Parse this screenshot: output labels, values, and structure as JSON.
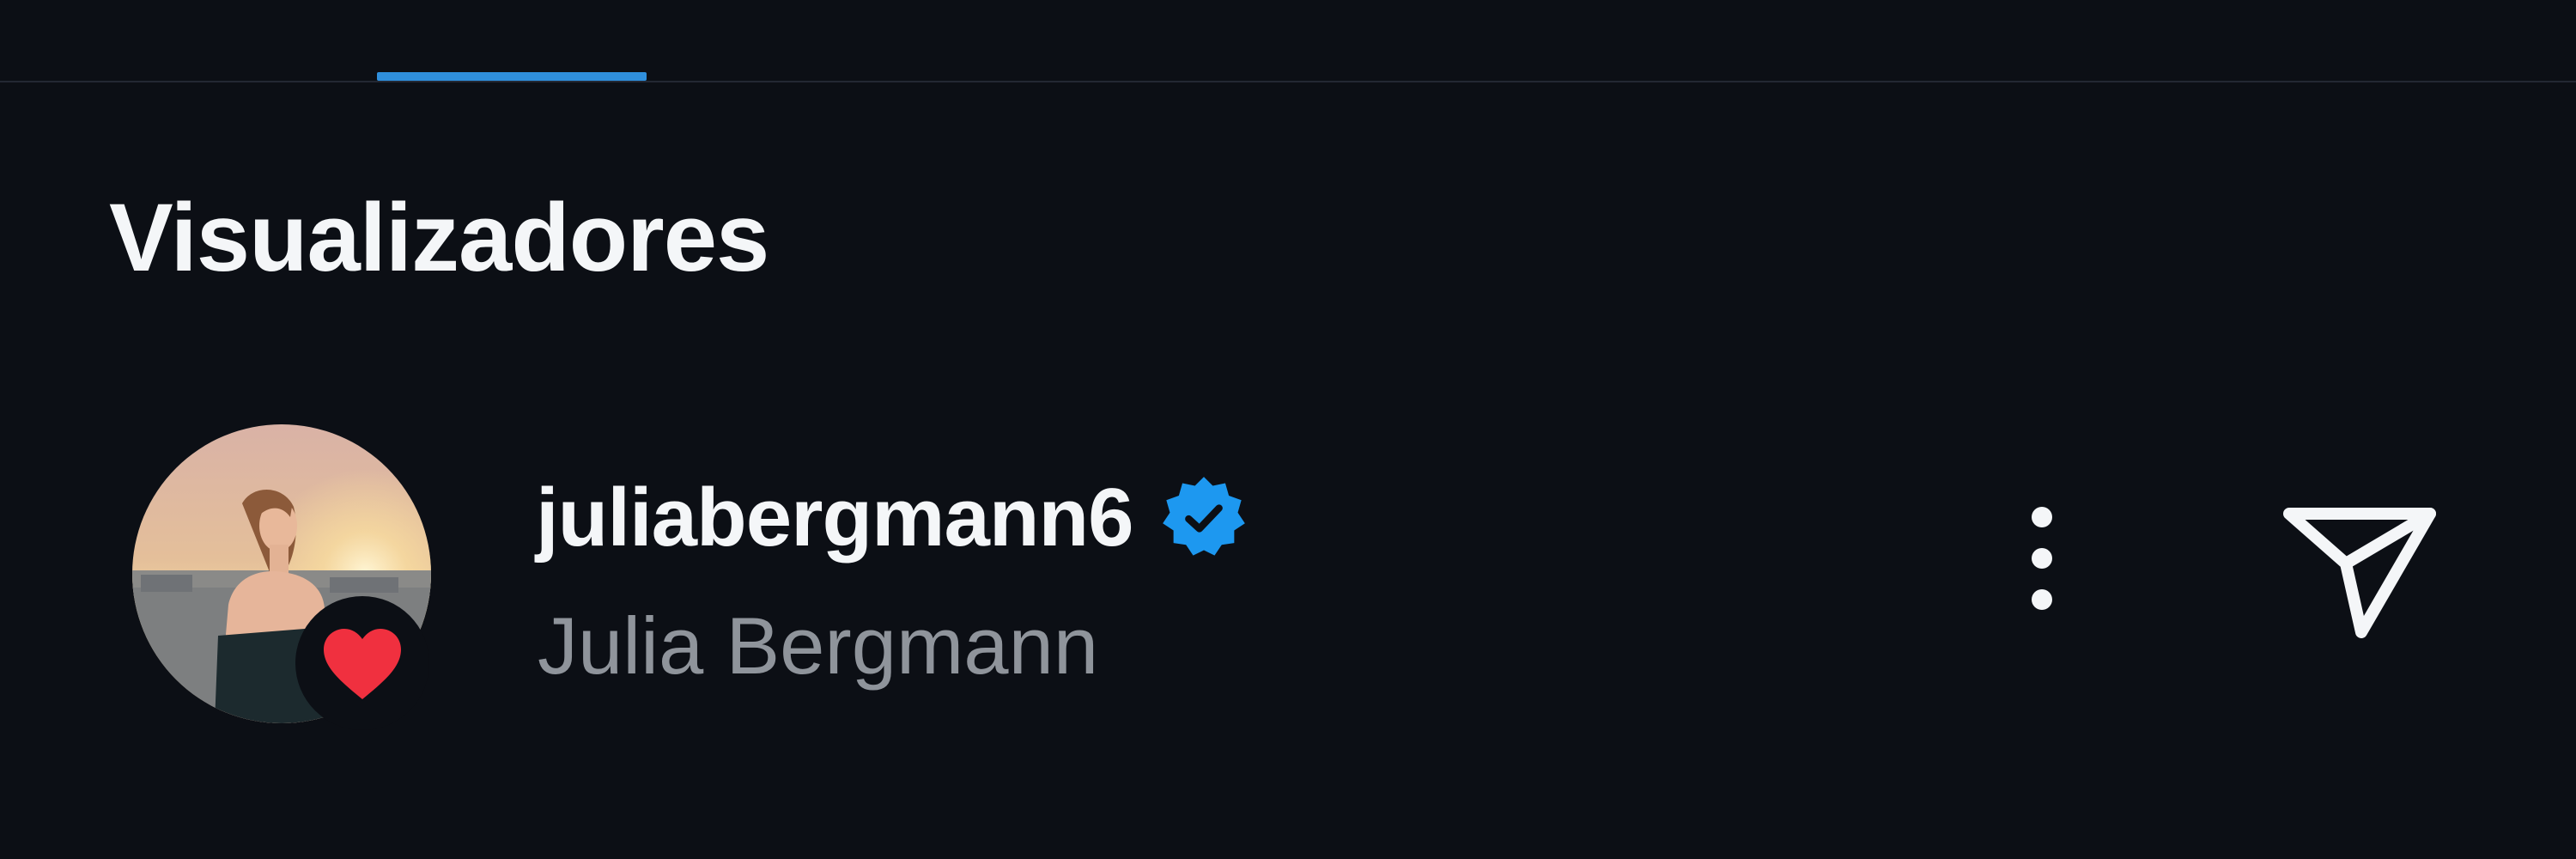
{
  "tabs": {
    "active_indicator_color": "#2f8fdc"
  },
  "section": {
    "title": "Visualizadores"
  },
  "viewers": [
    {
      "username": "juliabergmann6",
      "full_name": "Julia Bergmann",
      "verified": true,
      "liked": true,
      "avatar_icon": "profile-photo",
      "badge_icon": "heart-icon",
      "actions": [
        "more-options-icon",
        "send-icon"
      ]
    }
  ],
  "colors": {
    "background": "#0c0f15",
    "verified_blue": "#1d98f0",
    "like_red": "#f0303f",
    "secondary_text": "#8f949b",
    "primary_text": "#f4f6f8"
  }
}
